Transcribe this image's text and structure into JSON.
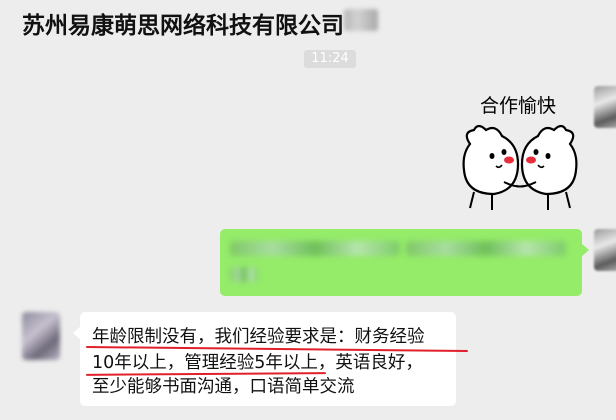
{
  "header": {
    "title": "苏州易康萌思网络科技有限公司"
  },
  "chat": {
    "timestamp": "11:24",
    "sticker": {
      "caption": "合作愉快"
    },
    "reply": {
      "lines": [
        "年龄限制没有，我们经验要求是：财务经验",
        "10年以上，管理经验5年以上，英语良好，",
        "至少能够书面沟通，口语简单交流"
      ]
    }
  },
  "colors": {
    "background": "#ededed",
    "sent_bubble": "#95ec69",
    "received_bubble": "#ffffff",
    "underline": "#e0202a"
  }
}
